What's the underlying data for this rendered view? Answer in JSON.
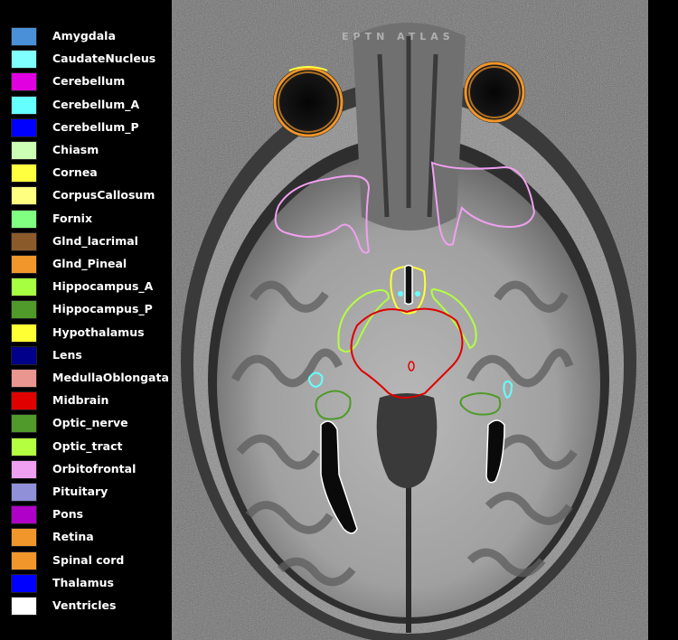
{
  "title": "EPTN ATLAS",
  "legend": [
    {
      "label": "Amygdala",
      "color": "#4a90d9"
    },
    {
      "label": "CaudateNucleus",
      "color": "#80ffff"
    },
    {
      "label": "Cerebellum",
      "color": "#e000e0"
    },
    {
      "label": "Cerebellum_A",
      "color": "#66ffff"
    },
    {
      "label": "Cerebellum_P",
      "color": "#0000ff"
    },
    {
      "label": "Chiasm",
      "color": "#ccffb3"
    },
    {
      "label": "Cornea",
      "color": "#ffff40"
    },
    {
      "label": "CorpusCallosum",
      "color": "#ffff80"
    },
    {
      "label": "Fornix",
      "color": "#80ff80"
    },
    {
      "label": "Glnd_lacrimal",
      "color": "#8b5a2b"
    },
    {
      "label": "Glnd_Pineal",
      "color": "#f0962a"
    },
    {
      "label": "Hippocampus_A",
      "color": "#a6ff40"
    },
    {
      "label": "Hippocampus_P",
      "color": "#4f9a2a"
    },
    {
      "label": "Hypothalamus",
      "color": "#ffff33"
    },
    {
      "label": "Lens",
      "color": "#00008b"
    },
    {
      "label": "MedullaOblongata",
      "color": "#e8968f"
    },
    {
      "label": "Midbrain",
      "color": "#e00000"
    },
    {
      "label": "Optic_nerve",
      "color": "#4f9a2a"
    },
    {
      "label": "Optic_tract",
      "color": "#b3ff40"
    },
    {
      "label": "Orbitofrontal",
      "color": "#f0a0f0"
    },
    {
      "label": "Pituitary",
      "color": "#9090d8"
    },
    {
      "label": "Pons",
      "color": "#b000c8"
    },
    {
      "label": "Retina",
      "color": "#f0962a"
    },
    {
      "label": "Spinal cord",
      "color": "#f0962a"
    },
    {
      "label": "Thalamus",
      "color": "#0000ff"
    },
    {
      "label": "Ventricles",
      "color": "#ffffff"
    }
  ]
}
